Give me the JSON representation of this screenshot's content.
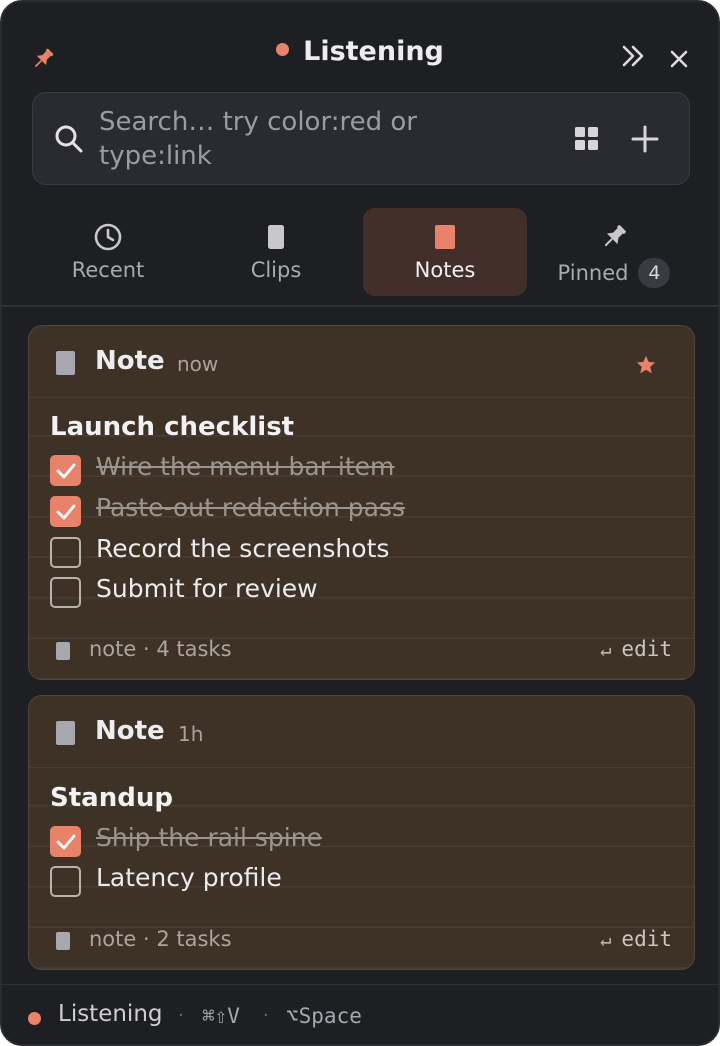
{
  "window": {
    "title": "Listening"
  },
  "search": {
    "placeholder": "Search… try color:red or type:link",
    "icons": [
      "search-icon",
      "grid-icon",
      "plus-icon"
    ]
  },
  "tabs": [
    {
      "label": "Recent",
      "icon": "clock-icon",
      "active": false
    },
    {
      "label": "Clips",
      "icon": "clip-icon",
      "active": false
    },
    {
      "label": "Notes",
      "icon": "note-icon",
      "active": true
    },
    {
      "label": "Pinned",
      "icon": "pin-icon",
      "active": false,
      "badge": "4"
    }
  ],
  "cards": [
    {
      "type_label": "Note",
      "time": "now",
      "starred": true,
      "title": "Launch checklist",
      "tasks": [
        {
          "text": "Wire the menu bar item",
          "done": true
        },
        {
          "text": "Paste-out redaction pass",
          "done": true
        },
        {
          "text": "Record the screenshots",
          "done": false
        },
        {
          "text": "Submit for review",
          "done": false
        }
      ],
      "footer_meta": "note · 4 tasks",
      "edit_label": "edit",
      "edit_key": "↵"
    },
    {
      "type_label": "Note",
      "time": "1h",
      "starred": false,
      "title": "Standup",
      "tasks": [
        {
          "text": "Ship the rail spine",
          "done": true
        },
        {
          "text": "Latency profile",
          "done": false
        }
      ],
      "footer_meta": "note · 2 tasks",
      "edit_label": "edit",
      "edit_key": "↵"
    }
  ],
  "footer": {
    "status": "Listening",
    "separator": "·",
    "shortcut_paste": "⌘⇧V",
    "shortcut_toggle": "⌥Space"
  },
  "colors": {
    "accent": "#e8826a",
    "panel_bg": "#1e1f23",
    "card_bg": "#3e3226",
    "active_tab_bg": "#432f2a"
  }
}
